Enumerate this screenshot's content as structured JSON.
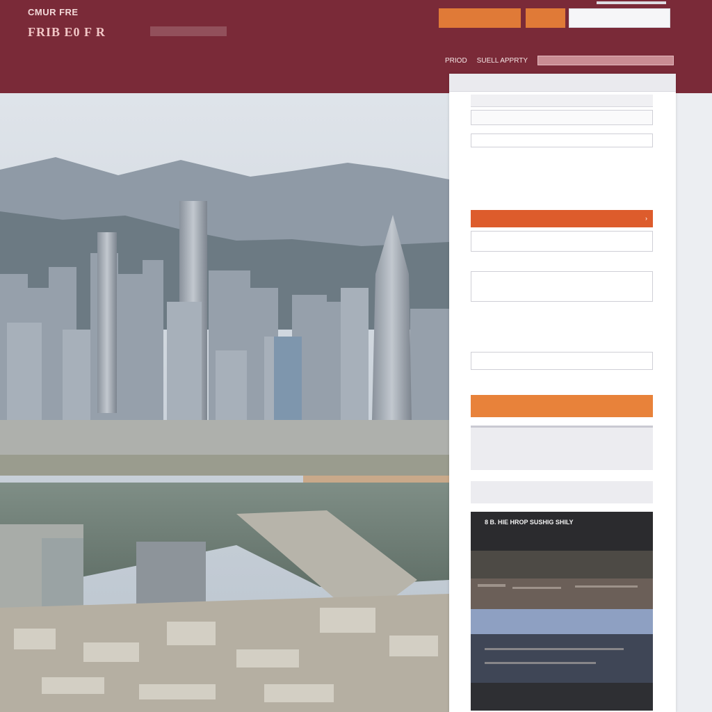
{
  "header": {
    "logo_text": "CMUR FRE",
    "brand": "FRIB E0 F R",
    "brand_sub": "",
    "links": [
      "",
      ""
    ],
    "tagline": "",
    "top_note": "",
    "btn_primary": "",
    "btn_secondary": "",
    "search_placeholder": "",
    "nav": [
      "PRIOD",
      "SUELL APPRTY"
    ]
  },
  "hero": {
    "nav_items": [
      "",
      "",
      "",
      "",
      "",
      ""
    ]
  },
  "panel": {
    "section_label": "",
    "row_left": "",
    "row_mid": "",
    "row_right": "",
    "input_1": "",
    "heading_1": "",
    "text_1": "",
    "tag_1": "",
    "tag_2": "",
    "banner_text": "",
    "box_1_text": "",
    "subheading": "",
    "box_2_text": "",
    "heading_2": "",
    "text_2": "",
    "input_2": "",
    "cta_text": "",
    "grey_title": "",
    "grey_text": "",
    "grey_text_2": "",
    "grey2_text": "",
    "dark_title": "8 B. HIE HROP SUSHIG SHILY",
    "dark_sub": ""
  }
}
